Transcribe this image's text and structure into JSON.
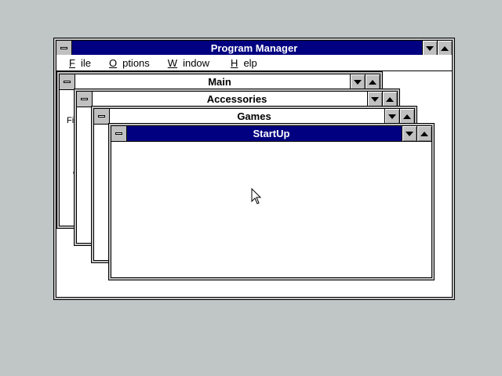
{
  "program_manager": {
    "title": "Program Manager",
    "menu": [
      {
        "label": "File",
        "underline": "F",
        "rest": "ile"
      },
      {
        "label": "Options",
        "underline": "O",
        "rest": "ptions"
      },
      {
        "label": "Window",
        "underline": "W",
        "rest": "indow"
      },
      {
        "label": "Help",
        "underline": "H",
        "rest": "elp"
      }
    ]
  },
  "groups": {
    "main": {
      "title": "Main",
      "peek_text_1": "Fi",
      "peek_text_2": "W"
    },
    "accessories": {
      "title": "Accessories"
    },
    "games": {
      "title": "Games"
    },
    "startup": {
      "title": "StartUp"
    }
  },
  "colors": {
    "desktop": "#c0c5c5",
    "active_title": "#000080",
    "inactive_title": "#ffffff"
  },
  "icons": [
    "system-menu-icon",
    "minimize-icon",
    "maximize-icon",
    "mouse-pointer-icon"
  ]
}
